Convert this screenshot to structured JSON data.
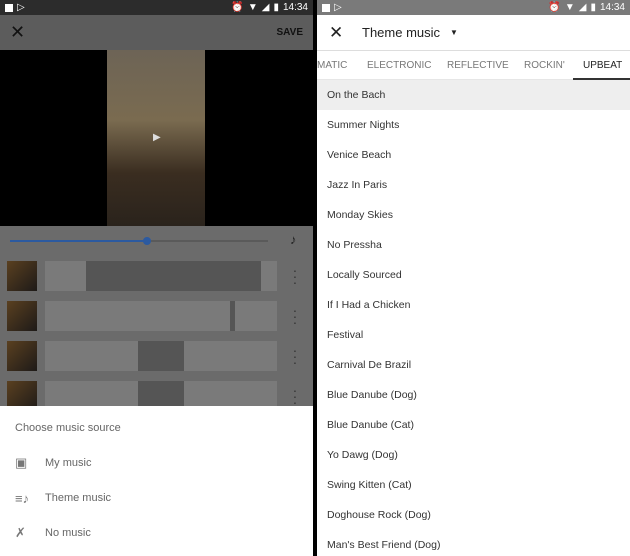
{
  "status": {
    "time": "14:34"
  },
  "editor": {
    "close_icon": "close-icon",
    "save_label": "SAVE",
    "play_icon": "play-icon",
    "music_icon": "music-note-icon",
    "slider_progress": 0.53
  },
  "sheet": {
    "title": "Choose music source",
    "options": [
      {
        "label": "My music",
        "icon": "music-library-icon"
      },
      {
        "label": "Theme music",
        "icon": "playlist-music-icon"
      },
      {
        "label": "No music",
        "icon": "music-off-icon"
      }
    ]
  },
  "theme": {
    "title": "Theme music",
    "tabs": [
      "MATIC",
      "ELECTRONIC",
      "REFLECTIVE",
      "ROCKIN'",
      "UPBEAT"
    ],
    "active_tab": "UPBEAT",
    "tracks": [
      "On the Bach",
      "Summer Nights",
      "Venice Beach",
      "Jazz In Paris",
      "Monday Skies",
      "No Pressha",
      "Locally Sourced",
      "If I Had a Chicken",
      "Festival",
      "Carnival De Brazil",
      "Blue Danube (Dog)",
      "Blue Danube (Cat)",
      "Yo Dawg (Dog)",
      "Swing Kitten (Cat)",
      "Doghouse Rock (Dog)",
      "Man's Best Friend (Dog)"
    ],
    "selected_track": "On the Bach"
  }
}
